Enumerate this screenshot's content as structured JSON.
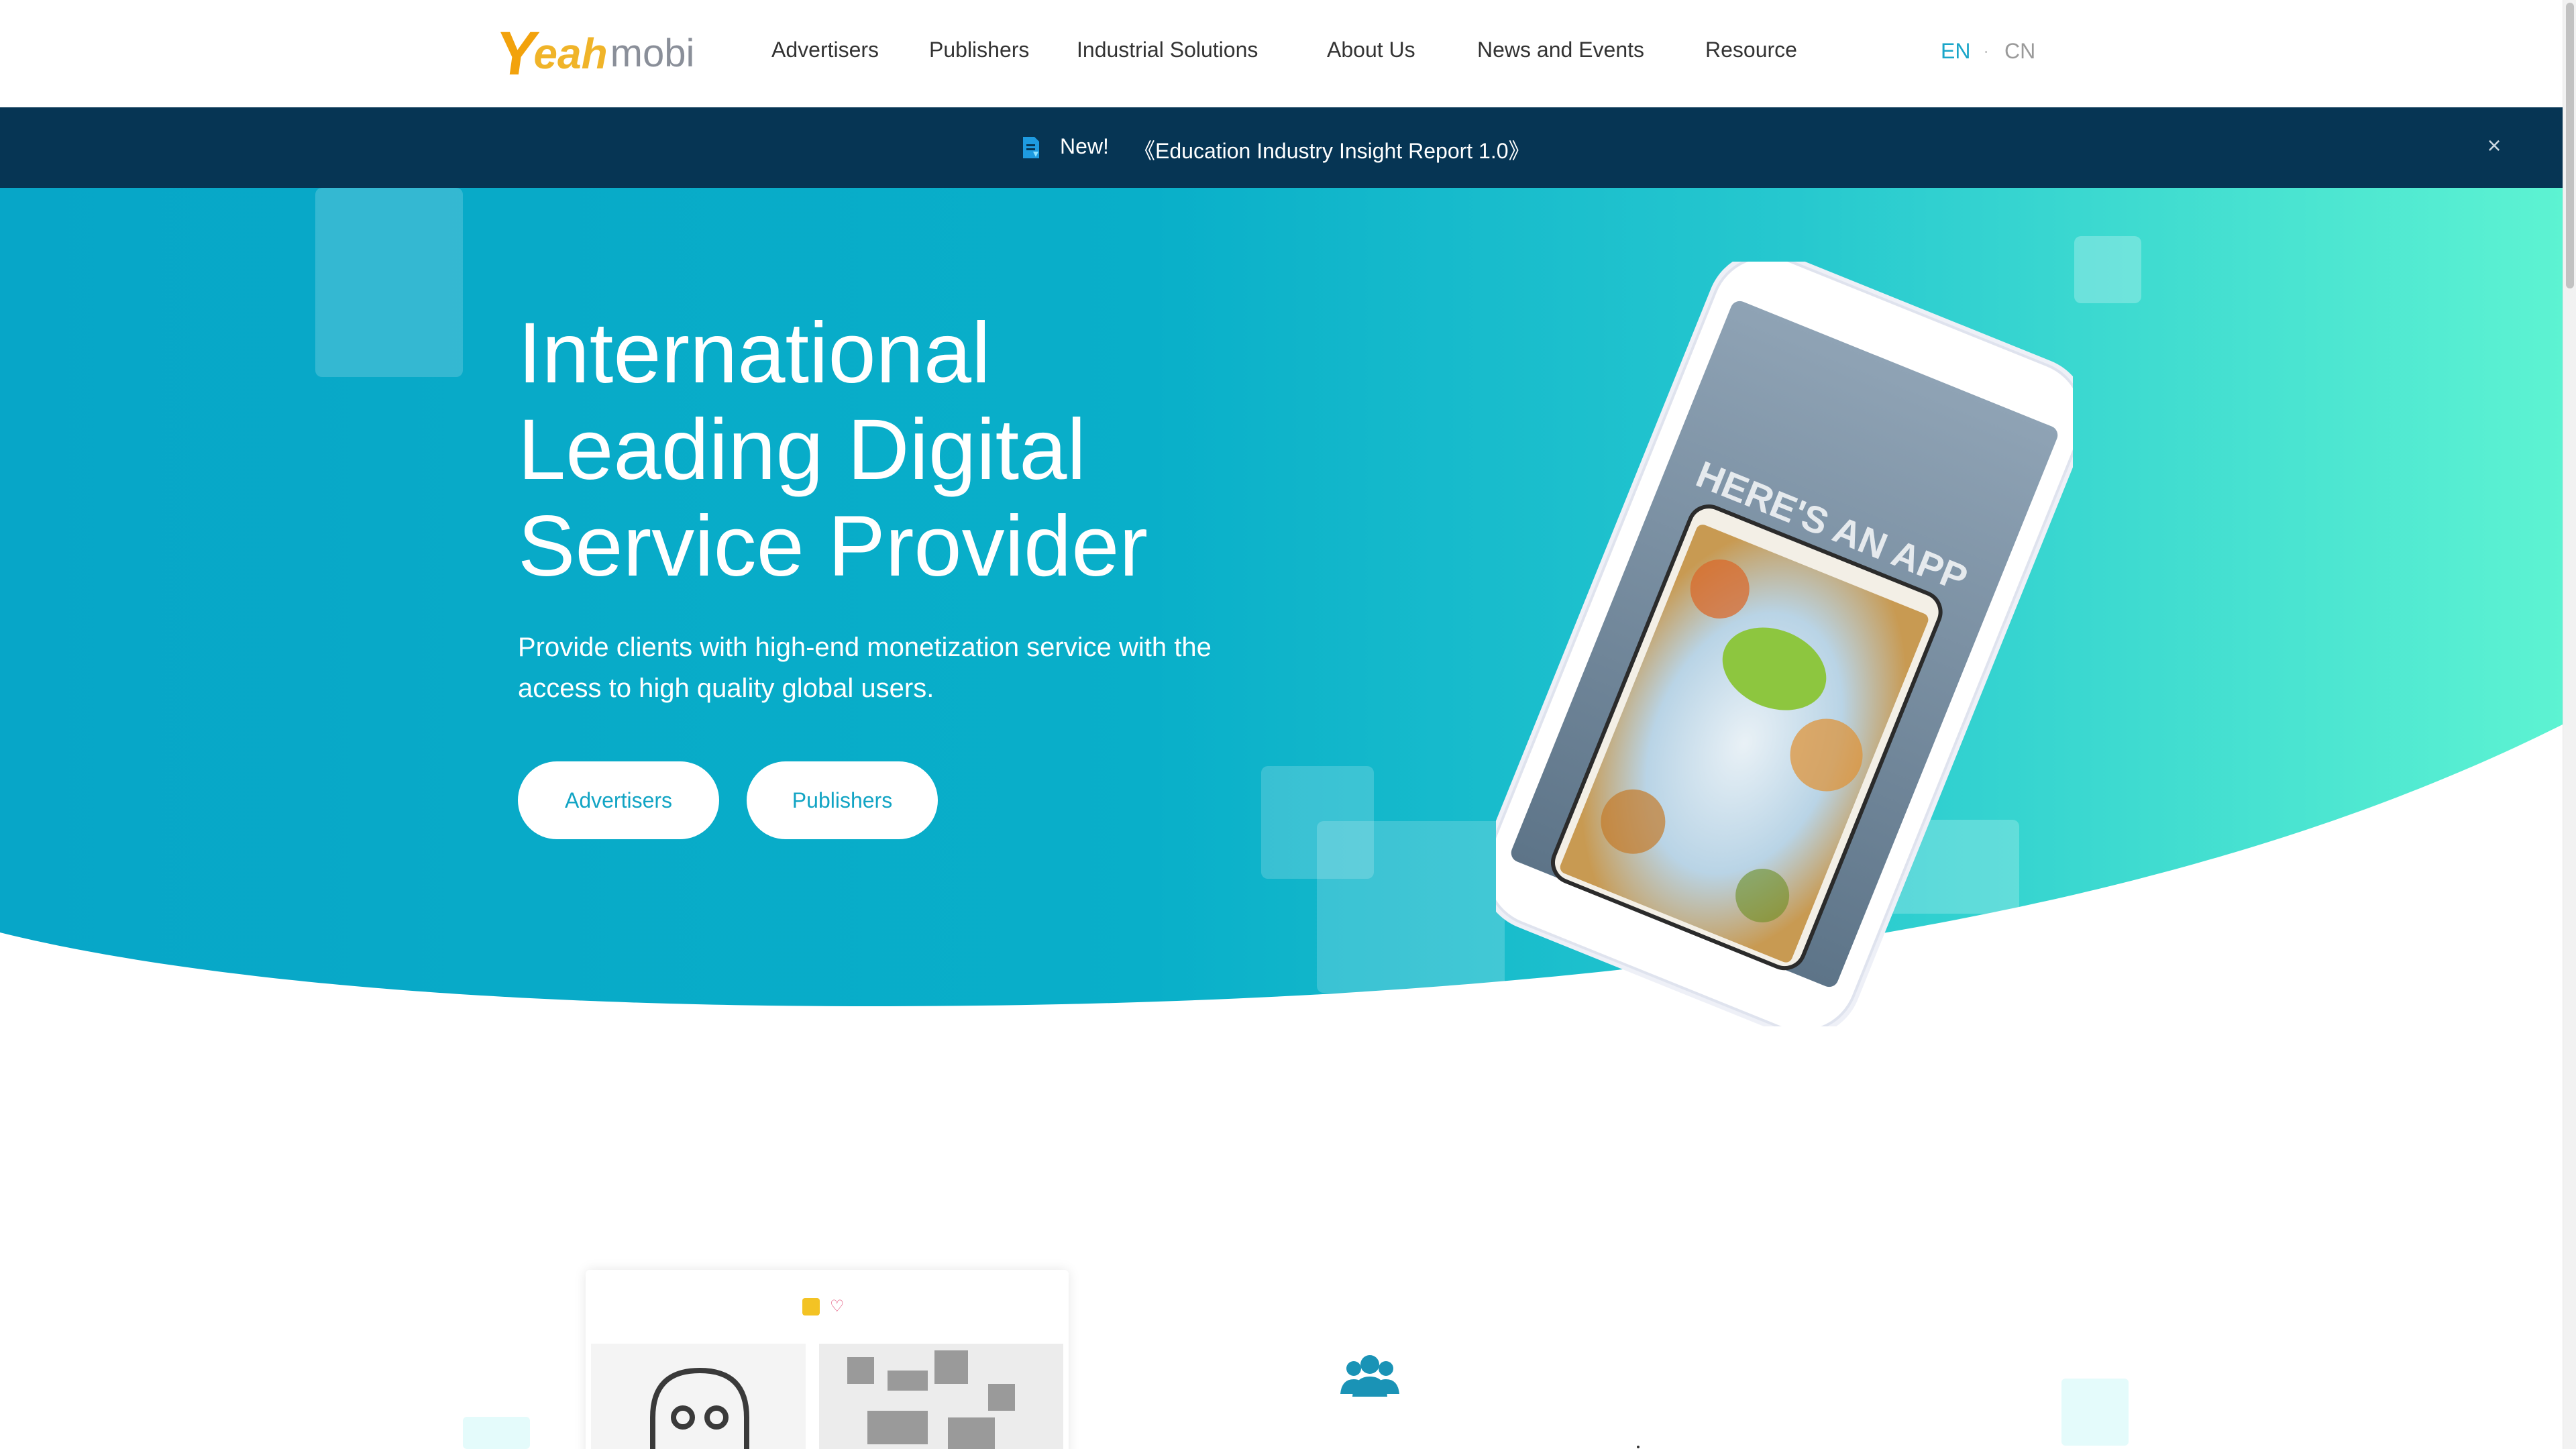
{
  "brand": {
    "logo_y": "Y",
    "logo_eah": "eah",
    "logo_mobi": "mobi",
    "logo_alt": "Yeahmobi"
  },
  "nav": {
    "items": [
      {
        "label": "Advertisers"
      },
      {
        "label": "Publishers"
      },
      {
        "label": "Industrial Solutions"
      },
      {
        "label": "About Us"
      },
      {
        "label": "News and Events"
      },
      {
        "label": "Resource"
      }
    ],
    "lang_en": "EN",
    "lang_sep": "·",
    "lang_cn": "CN",
    "active_lang": "EN"
  },
  "announcement": {
    "icon": "document-icon",
    "new_label": "New!",
    "text": "《Education Industry Insight Report 1.0》",
    "close_label": "×"
  },
  "hero": {
    "title": "International\nLeading Digital\nService Provider",
    "subtitle": "Provide clients with high-end monetization service with the access to high quality global users.",
    "button_advertisers": "Advertisers",
    "button_publishers": "Publishers",
    "phone_screen_text": "HERE'S AN APP"
  },
  "colors": {
    "nav_active": "#1aa6c9",
    "announcement_bg": "#063554",
    "hero_gradient_start": "#07a6c8",
    "hero_gradient_end": "#5df3d2",
    "button_text": "#11a4c4",
    "logo_orange": "#f2a20c",
    "logo_gray": "#8a8f99"
  },
  "lower": {
    "group_icon": "users-group-icon",
    "card_icons": [
      "yellow-square-icon",
      "heart-icon"
    ]
  }
}
